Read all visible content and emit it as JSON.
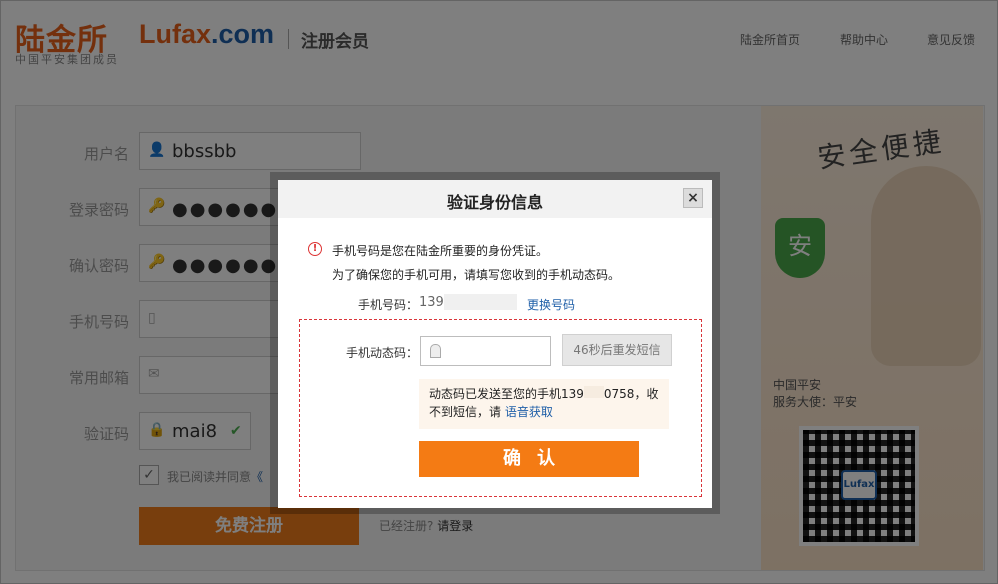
{
  "header": {
    "logo_cn": "陆金所",
    "logo_sub": "中国平安集团成员",
    "logo_en_main": "Lufax",
    "logo_en_domain": ".com",
    "page_title": "注册会员",
    "nav": [
      "陆金所首页",
      "帮助中心",
      "意见反馈"
    ]
  },
  "form": {
    "labels": [
      "用户名",
      "登录密码",
      "确认密码",
      "手机号码",
      "常用邮箱",
      "验证码"
    ],
    "username": "bbssbb",
    "password_mask": "●●●●●●●●●●●",
    "confirm_mask": "●●●●●●●●●●●",
    "captcha": "mai8",
    "agree_text": "我已阅读并同意",
    "agree_link": "《",
    "register_button": "免费注册",
    "login_hint": "已经注册?",
    "login_link": "请登录"
  },
  "promo": {
    "slogan": "安全便捷",
    "shield_char": "安",
    "line1": "中国平安",
    "line2": "服务大使：平安",
    "qr_badge": "Lufax"
  },
  "modal": {
    "title": "验证身份信息",
    "close": "×",
    "notice_line1": "手机号码是您在陆金所重要的身份凭证。",
    "notice_line2": "为了确保您的手机可用，请填写您收到的手机动态码。",
    "phone_label": "手机号码：",
    "phone_value": "139",
    "change_phone": "更换号码",
    "code_label": "手机动态码：",
    "code_placeholder": "",
    "resend_button": "46秒后重发短信",
    "sent_text": "动态码已发送至您的手机139",
    "sent_text_tail": "0758，收不到短信，请",
    "voice_link": "语音获取",
    "confirm_button": "确认"
  }
}
